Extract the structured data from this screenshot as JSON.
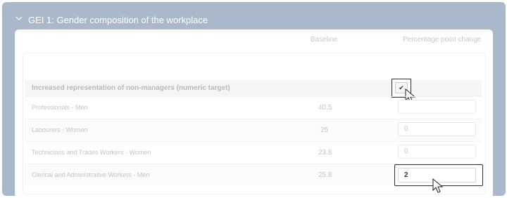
{
  "section": {
    "title": "GEI 1: Gender composition of the workplace"
  },
  "table": {
    "headers": {
      "baseline": "Baseline",
      "change": "Percentage point change"
    },
    "group": {
      "label": "Increased representation of non-managers (numeric target)",
      "checked": true,
      "check_glyph": "✔"
    },
    "rows": [
      {
        "label": "Professionals - Men",
        "baseline": "40.5",
        "value": ""
      },
      {
        "label": "Labourers - Women",
        "baseline": "25",
        "value": "0"
      },
      {
        "label": "Technicians and Trades Workers - Women",
        "baseline": "23.8",
        "value": "0"
      },
      {
        "label": "Clerical and Administrative Workers - Men",
        "baseline": "25.8",
        "value": "2"
      }
    ]
  },
  "icons": {
    "collapse": "chevron-down-icon",
    "pointer": "mouse-pointer-icon"
  },
  "colors": {
    "frame": "#a9b9cb",
    "card": "#ffffff"
  }
}
